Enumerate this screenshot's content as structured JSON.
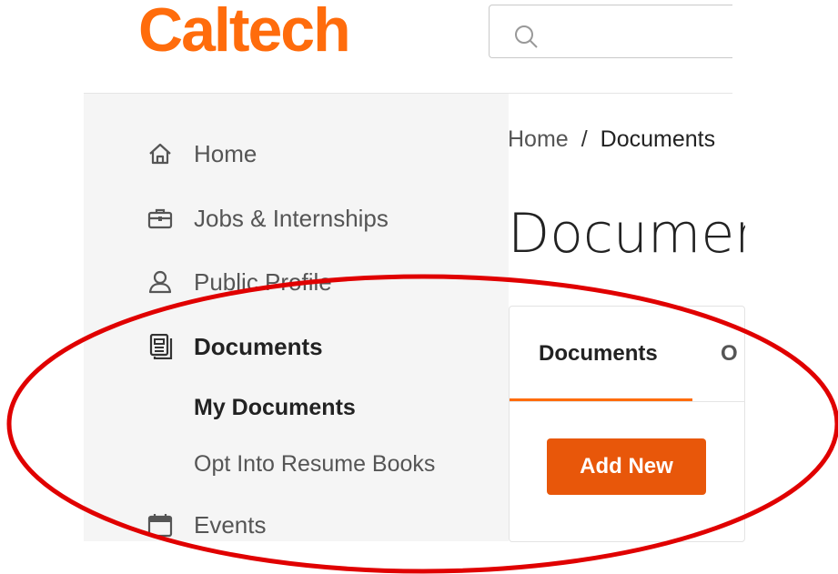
{
  "header": {
    "logo_text": "Caltech",
    "search_icon": "search-icon",
    "search_placeholder": ""
  },
  "sidebar": {
    "items": [
      {
        "label": "Home",
        "icon": "home-icon"
      },
      {
        "label": "Jobs & Internships",
        "icon": "briefcase-icon"
      },
      {
        "label": "Public Profile",
        "icon": "user-icon"
      },
      {
        "label": "Documents",
        "icon": "document-icon",
        "active": true
      },
      {
        "label": "Events",
        "icon": "calendar-icon"
      }
    ],
    "sub_items": [
      {
        "label": "My Documents",
        "active": true
      },
      {
        "label": "Opt Into Resume Books"
      }
    ]
  },
  "breadcrumb": {
    "home": "Home",
    "separator": "/",
    "current": "Documents"
  },
  "main": {
    "title": "Documents",
    "tabs": [
      {
        "label": "Documents",
        "active": true
      },
      {
        "label": "O"
      }
    ],
    "add_button": "Add New"
  },
  "colors": {
    "brand": "#ff6c0c",
    "button": "#e8570a",
    "annotation": "#e00000"
  }
}
